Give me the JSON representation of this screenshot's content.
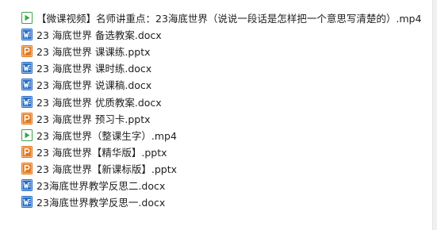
{
  "files": [
    {
      "name": "【微课视频】名师讲重点：23海底世界（说说一段话是怎样把一个意思写清楚的）.mp4",
      "type": "video",
      "icon": "video-file-icon"
    },
    {
      "name": "23 海底世界 备选教案.docx",
      "type": "docx",
      "icon": "word-file-icon"
    },
    {
      "name": "23 海底世界 课课练.pptx",
      "type": "pptx",
      "icon": "powerpoint-file-icon"
    },
    {
      "name": "23 海底世界 课时练.docx",
      "type": "docx",
      "icon": "word-file-icon"
    },
    {
      "name": "23 海底世界 说课稿.docx",
      "type": "docx",
      "icon": "word-file-icon"
    },
    {
      "name": "23 海底世界 优质教案.docx",
      "type": "docx",
      "icon": "word-file-icon"
    },
    {
      "name": "23 海底世界 预习卡.pptx",
      "type": "pptx",
      "icon": "powerpoint-file-icon"
    },
    {
      "name": "23 海底世界（整课生字）.mp4",
      "type": "video",
      "icon": "video-file-icon"
    },
    {
      "name": "23 海底世界【精华版】.pptx",
      "type": "pptx",
      "icon": "powerpoint-file-icon"
    },
    {
      "name": "23 海底世界【新课标版】.pptx",
      "type": "pptx",
      "icon": "powerpoint-file-icon"
    },
    {
      "name": "23海底世界教学反思二.docx",
      "type": "docx",
      "icon": "word-file-icon"
    },
    {
      "name": "23海底世界教学反思一.docx",
      "type": "docx",
      "icon": "word-file-icon"
    }
  ],
  "colors": {
    "word": "#2b6fc6",
    "powerpoint": "#e07a1e",
    "video": "#3aa64a"
  }
}
